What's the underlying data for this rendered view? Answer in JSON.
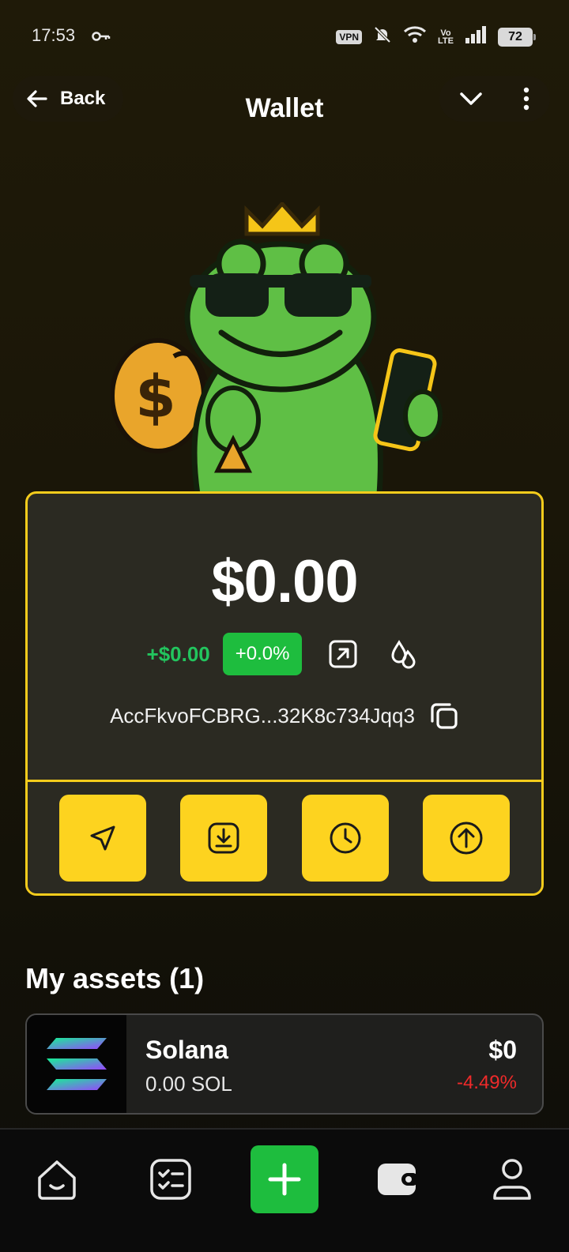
{
  "status_bar": {
    "time": "17:53",
    "vpn": "VPN",
    "volte_top": "Vo",
    "volte_bottom": "LTE",
    "battery": "72"
  },
  "header": {
    "back_label": "Back",
    "title": "Wallet"
  },
  "wallet": {
    "balance": "$0.00",
    "change_amount": "+$0.00",
    "change_percent": "+0.0%",
    "address": "AccFkvoFCBRG...32K8c734Jqq3"
  },
  "assets": {
    "title": "My assets (1)",
    "items": [
      {
        "name": "Solana",
        "amount": "0.00 SOL",
        "value": "$0",
        "change": "-4.49%"
      }
    ]
  },
  "colors": {
    "accent_yellow": "#fdd31f",
    "positive_green": "#1ebd3e",
    "negative_red": "#ef2a2a"
  },
  "icons": {
    "actions": [
      "send-icon",
      "receive-icon",
      "history-icon",
      "upload-icon"
    ],
    "nav": [
      "home-icon",
      "tasks-icon",
      "plus-icon",
      "wallet-icon",
      "profile-icon"
    ]
  }
}
